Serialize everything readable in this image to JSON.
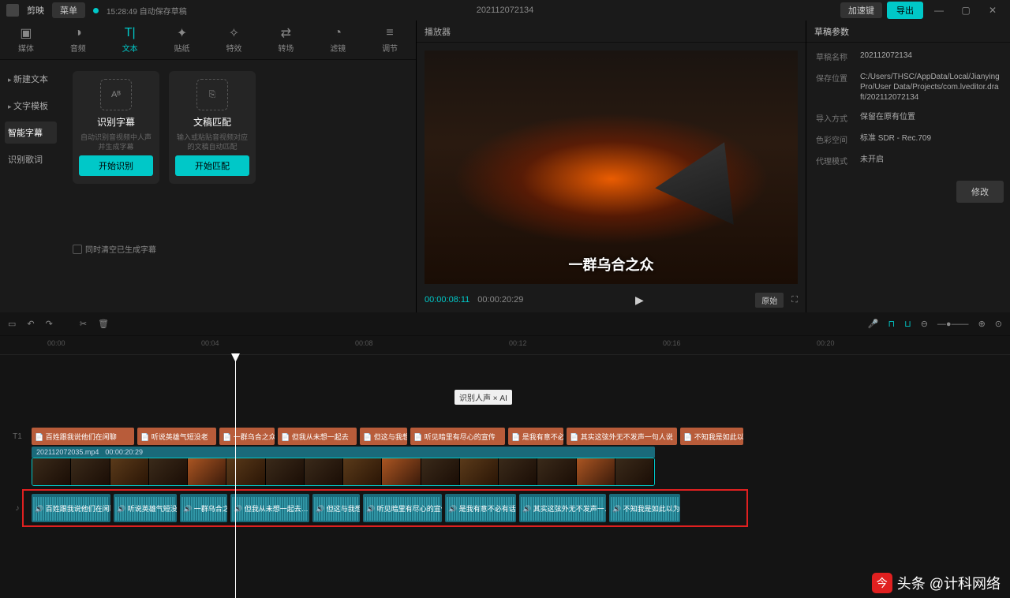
{
  "titlebar": {
    "app": "剪映",
    "menu": "菜单",
    "saved_at": "15:28:49 自动保存草稿",
    "project_name": "202112072134",
    "vip": "加速键",
    "export": "导出"
  },
  "tools": [
    {
      "label": "媒体",
      "icon": "▣"
    },
    {
      "label": "音频",
      "icon": "◑"
    },
    {
      "label": "文本",
      "icon": "T|"
    },
    {
      "label": "贴纸",
      "icon": "✦"
    },
    {
      "label": "特效",
      "icon": "✧"
    },
    {
      "label": "转场",
      "icon": "⇄"
    },
    {
      "label": "滤镜",
      "icon": "◔"
    },
    {
      "label": "调节",
      "icon": "≡"
    }
  ],
  "sub_sidebar": [
    {
      "label": "新建文本"
    },
    {
      "label": "文字模板"
    },
    {
      "label": "智能字幕",
      "active": true,
      "plain": true
    },
    {
      "label": "识别歌词",
      "plain": true
    }
  ],
  "cards": [
    {
      "title": "识别字幕",
      "desc": "自动识别音视频中人声并生成字幕",
      "btn": "开始识别"
    },
    {
      "title": "文稿匹配",
      "desc": "输入或粘贴音视频对应的文稿自动匹配",
      "btn": "开始匹配"
    }
  ],
  "clear_checkbox": "同时清空已生成字幕",
  "center_header": "播放器",
  "preview_subtitle": "一群乌合之众",
  "play": {
    "current": "00:00:08:11",
    "total": "00:00:20:29",
    "ratio": "原始"
  },
  "right_panel": {
    "header": "草稿参数",
    "rows": [
      {
        "label": "草稿名称",
        "val": "202112072134"
      },
      {
        "label": "保存位置",
        "val": "C:/Users/THSC/AppData/Local/JianyingPro/User Data/Projects/com.lveditor.draft/202112072134"
      },
      {
        "label": "导入方式",
        "val": "保留在原有位置"
      },
      {
        "label": "色彩空间",
        "val": "标准 SDR - Rec.709"
      },
      {
        "label": "代理模式",
        "val": "未开启"
      }
    ],
    "modify": "修改"
  },
  "timeline": {
    "ticks": [
      "00:00",
      "00:04",
      "00:08",
      "00:12",
      "00:16",
      "00:20"
    ],
    "tooltip": "识别人声 × AI",
    "subtitle_clips": [
      "百姓跟我说他们在闲聊",
      "听说英雄气短没老",
      "一群乌合之众",
      "但我从未想一起去",
      "但这与我想",
      "听见暗里有尽心的宣传",
      "是我有意不必",
      "其实这弦外无不发声一句人说",
      "不知我是如此以无后"
    ],
    "video_header": {
      "name": "202112072035.mp4",
      "dur": "00:00:20:29"
    },
    "audio_clips": [
      "百姓跟我说他们在闲聊…",
      "听说英雄气短没老",
      "一群乌合之众",
      "但我从未想一起去…",
      "但这与我想",
      "听见暗里有尽心的宣传",
      "是我有意不必有话…",
      "其实这弦外无不发声一…",
      "不知我是如此以为后"
    ]
  },
  "watermark": "头条 @计科网络"
}
